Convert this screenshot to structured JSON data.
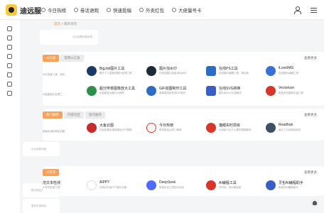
{
  "logo": {
    "text": "迪远服"
  },
  "nav": [
    {
      "label": "今日热榜",
      "icon": "flame-icon"
    },
    {
      "label": "卷话语观",
      "icon": "chat-icon"
    },
    {
      "label": "快速投稿",
      "icon": "send-icon"
    },
    {
      "label": "外卖红包",
      "icon": "gift-icon"
    },
    {
      "label": "大佬量号卡",
      "icon": "card-icon"
    }
  ],
  "breadcrumb": {
    "current": "首页",
    "sep": " > ",
    "page": "最新发布"
  },
  "notice": {
    "text": "点击查看详细说明"
  },
  "sections": [
    {
      "tabs": [
        "AI工具",
        "常用AI工具"
      ],
      "active_tab": 0,
      "more": "查看更多",
      "rows": [
        {
          "partial": {
            "title": "",
            "desc": "AI去背景工具，免安..."
          },
          "cards": [
            {
              "title": "BigJob图片工具",
              "desc": "基于人工智能的图片处理工具",
              "icon": "bigjob-icon",
              "color": "#1a3a66"
            },
            {
              "title": "图片加水印",
              "desc": "在线给图片批量添加水印",
              "icon": "watermark-icon",
              "color": "#1c2b3a"
            },
            {
              "title": "在线PS工具",
              "desc": "在线图片编辑工具，简约版",
              "icon": "ps-icon",
              "color": "#2b6cc4"
            },
            {
              "title": "iLoveIMG",
              "desc": "在线图片编辑工具",
              "icon": "iloveimg-icon",
              "color": "#3a6fd9"
            }
          ]
        },
        {
          "partial": {
            "title": "",
            "desc": "AI智能图片处理工..."
          },
          "cards": [
            {
              "title": "超分辨率图像放大工具",
              "desc": "AI智能放大图片分辨率",
              "icon": "upscale-icon",
              "color": "#2f8f4a"
            },
            {
              "title": "GIF动图制作工具",
              "desc": "简单易用的在线GIF制作",
              "icon": "gif-icon",
              "color": "#2b6cc4"
            },
            {
              "title": "在线SVG转换",
              "desc": "图片转SVG矢量格式",
              "icon": "svg-icon",
              "color": "#3a5fc4"
            },
            {
              "title": "Vectorizer",
              "desc": "免费的位图转矢量工具",
              "icon": "vectorizer-icon",
              "color": "#d9362b"
            }
          ]
        }
      ]
    },
    {
      "tabs": [
        "热门推荐",
        "内容社区",
        "技巧服务"
      ],
      "active_tab": 0,
      "more": "查看更多",
      "rows": [
        {
          "partial": {
            "title": "",
            "desc": "超级实用的网站合集"
          },
          "cards": [
            {
              "title": "大鱼云图",
              "desc": "在线查看全球疫情及天气预报",
              "icon": "tomato-icon",
              "color": "#c92b2b"
            },
            {
              "title": "今日热榜",
              "desc": "提供各站点热门榜单",
              "icon": "today-icon",
              "color": "#f5f5f5"
            },
            {
              "title": "猫眼实时票房",
              "desc": "为电影行业人士提供数据服务",
              "icon": "maoyan-icon",
              "color": "#d9362b"
            },
            {
              "title": "Readhub",
              "desc": "每天三分钟科技资讯",
              "icon": "readhub-icon",
              "color": "#3d5066"
            }
          ]
        }
      ]
    },
    {
      "tabs": [
        "AI写作"
      ],
      "active_tab": 0,
      "more": "查看更多",
      "rows": [
        {
          "partial": {
            "title": "范文本检测",
            "desc": "AI写作检测工具"
          },
          "cards": [
            {
              "title": "AIPPT",
              "desc": "在线AI生成PPT演示文稿",
              "icon": "aippt-icon",
              "color": "#ffffff"
            },
            {
              "title": "DeepSeek",
              "desc": "探索未至之境的AI对话",
              "icon": "deepseek-icon",
              "color": "#4d6bfe"
            },
            {
              "title": "AI编程工具",
              "desc": "写代码，用AI更高效",
              "icon": "ai-code-icon",
              "color": "#d9362b"
            },
            {
              "title": "灵包AI编程助手",
              "desc": "免费的AI编程助手",
              "icon": "coding-icon",
              "color": "#3a5fc4"
            }
          ]
        }
      ]
    }
  ],
  "mini_cards": [
    {
      "text": "点击查看详细"
    },
    {
      "text": "提交网站收录"
    },
    {
      "text": "更多好用网站"
    }
  ]
}
